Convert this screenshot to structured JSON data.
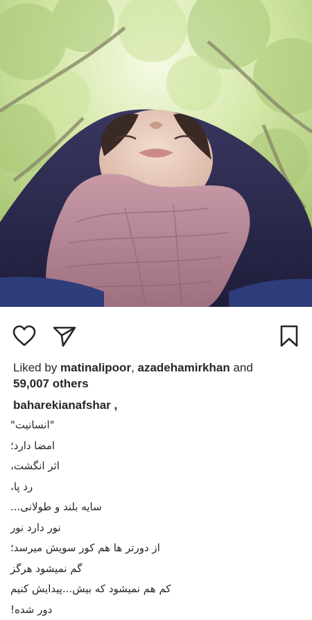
{
  "post": {
    "photo_alt": "photo"
  },
  "actions": {
    "like": "heart-icon",
    "share": "send-icon",
    "save": "bookmark-icon"
  },
  "likes": {
    "prefix": "Liked by ",
    "user1": "matinalipoor",
    "separator": ", ",
    "user2": "azadehamirkhan",
    "and": " and ",
    "count": "59,007 others"
  },
  "caption": {
    "username": "baharekianafshar ,",
    "lines": [
      "\"انسانیت\"",
      "امضا دارد؛",
      "اثر انگشت،",
      "رد پا،",
      "سایه بلند و طولانی...",
      "نور دارد نور",
      "از دورتر ها هم کور سویش میرسد؛",
      "گم نمیشود هرگز",
      "کم هم نمیشود که بیش...پیدایش کنیم",
      "دور شده!"
    ]
  },
  "colors": {
    "text": "#262626",
    "background": "#ffffff",
    "scarf": "#b88898",
    "hood": "#2c2a4e"
  }
}
